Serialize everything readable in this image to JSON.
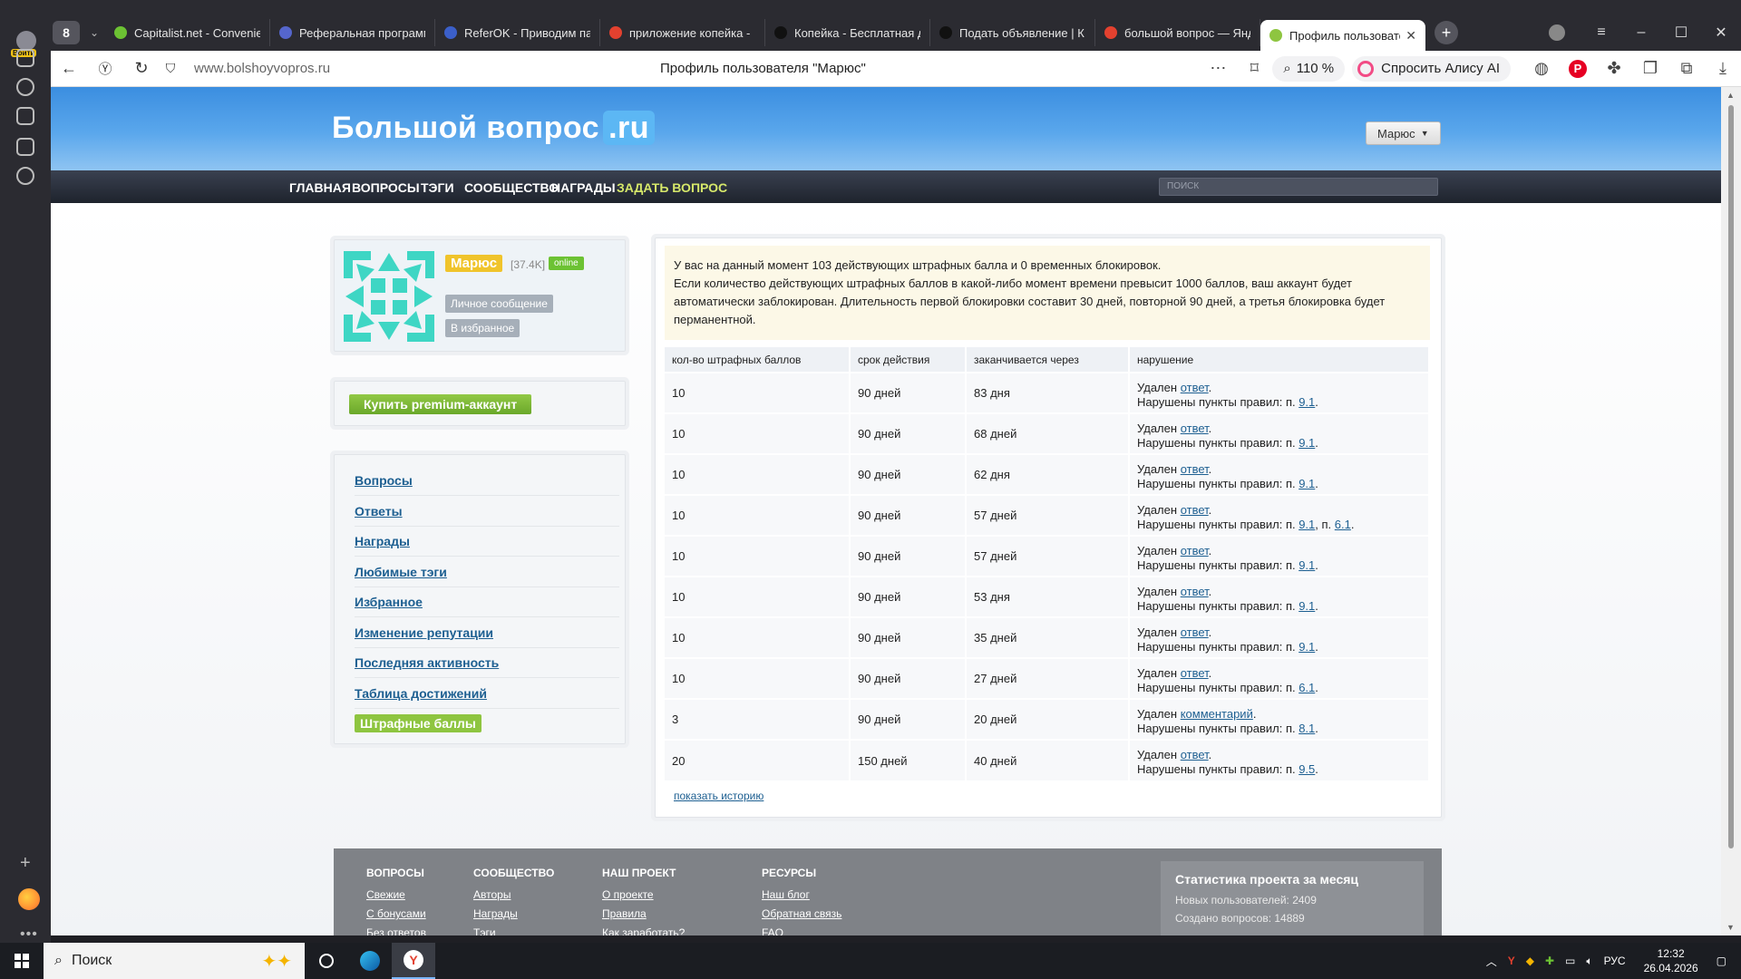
{
  "browser": {
    "tab_count": "8",
    "tabs": [
      {
        "label": "Capitalist.net - Convenie",
        "color": "#6cc233"
      },
      {
        "label": "Реферальная программа",
        "color": "#5566cc"
      },
      {
        "label": "ReferOK - Приводим пар",
        "color": "#3b5fc9"
      },
      {
        "label": "приложение копейка -",
        "color": "#e3412f"
      },
      {
        "label": "Копейка - Бесплатная д",
        "color": "#111111"
      },
      {
        "label": "Подать объявление | К",
        "color": "#111111"
      },
      {
        "label": "большой вопрос — Янд",
        "color": "#e3412f"
      },
      {
        "label": "Профиль пользовате",
        "color": "#8ec540"
      }
    ],
    "login_badge": "Войти",
    "url": "www.bolshoyvopros.ru",
    "page_title": "Профиль пользователя \"Марюс\"",
    "zoom": "110 %",
    "alice_label": "Спросить Алису AI"
  },
  "site": {
    "logo_main": "Большой вопрос",
    "logo_ru": ".ru",
    "user_menu": "Марюс",
    "nav": [
      {
        "label": "ГЛАВНАЯ",
        "ask": false
      },
      {
        "label": "ВОПРОСЫ",
        "ask": false
      },
      {
        "label": "ТЭГИ",
        "ask": false
      },
      {
        "label": "СООБЩЕСТВО",
        "ask": false
      },
      {
        "label": "НАГРАДЫ",
        "ask": false
      },
      {
        "label": "ЗАДАТЬ ВОПРОС",
        "ask": true
      }
    ],
    "search_placeholder": "ПОИСК"
  },
  "profile": {
    "username": "Марюс",
    "reputation": "[37.4K]",
    "online": "online",
    "private_message": "Личное сообщение",
    "add_favorite": "В избранное",
    "premium": "Купить premium-аккаунт"
  },
  "menu": [
    {
      "label": "Вопросы",
      "current": false
    },
    {
      "label": "Ответы",
      "current": false
    },
    {
      "label": "Награды",
      "current": false
    },
    {
      "label": "Любимые тэги",
      "current": false
    },
    {
      "label": "Избранное",
      "current": false
    },
    {
      "label": "Изменение репутации",
      "current": false
    },
    {
      "label": "Последняя активность",
      "current": false
    },
    {
      "label": "Таблица достижений",
      "current": false
    },
    {
      "label": "Штрафные баллы",
      "current": true
    }
  ],
  "notice": {
    "line1": "У вас на данный момент 103 действующих штрафных балла и 0 временных блокировок.",
    "line2": "Если количество действующих штрафных баллов в какой-либо момент времени превысит 1000 баллов, ваш аккаунт будет автоматически заблокирован. Длительность первой блокировки составит 30 дней, повторной 90 дней, а третья блокировка будет перманентной."
  },
  "table": {
    "headers": [
      "кол-во штрафных баллов",
      "срок действия",
      "заканчивается через",
      "нарушение"
    ],
    "removed_prefix": "Удален",
    "rules_prefix": "Нарушены пункты правил:",
    "rows": [
      {
        "points": "10",
        "duration": "90 дней",
        "ends": "83 дня",
        "object": "ответ",
        "rules": [
          "9.1"
        ]
      },
      {
        "points": "10",
        "duration": "90 дней",
        "ends": "68 дней",
        "object": "ответ",
        "rules": [
          "9.1"
        ]
      },
      {
        "points": "10",
        "duration": "90 дней",
        "ends": "62 дня",
        "object": "ответ",
        "rules": [
          "9.1"
        ]
      },
      {
        "points": "10",
        "duration": "90 дней",
        "ends": "57 дней",
        "object": "ответ",
        "rules": [
          "9.1",
          "6.1"
        ]
      },
      {
        "points": "10",
        "duration": "90 дней",
        "ends": "57 дней",
        "object": "ответ",
        "rules": [
          "9.1"
        ]
      },
      {
        "points": "10",
        "duration": "90 дней",
        "ends": "53 дня",
        "object": "ответ",
        "rules": [
          "9.1"
        ]
      },
      {
        "points": "10",
        "duration": "90 дней",
        "ends": "35 дней",
        "object": "ответ",
        "rules": [
          "9.1"
        ]
      },
      {
        "points": "10",
        "duration": "90 дней",
        "ends": "27 дней",
        "object": "ответ",
        "rules": [
          "6.1"
        ]
      },
      {
        "points": "3",
        "duration": "90 дней",
        "ends": "20 дней",
        "object": "комментарий",
        "rules": [
          "8.1"
        ]
      },
      {
        "points": "20",
        "duration": "150 дней",
        "ends": "40 дней",
        "object": "ответ",
        "rules": [
          "9.5"
        ]
      }
    ],
    "history_link": "показать историю"
  },
  "footer": {
    "columns": [
      {
        "title": "ВОПРОСЫ",
        "links": [
          "Свежие",
          "С бонусами",
          "Без ответов"
        ]
      },
      {
        "title": "СООБЩЕСТВО",
        "links": [
          "Авторы",
          "Награды",
          "Тэги"
        ]
      },
      {
        "title": "НАШ ПРОЕКТ",
        "links": [
          "О проекте",
          "Правила",
          "Как заработать?"
        ]
      },
      {
        "title": "РЕСУРСЫ",
        "links": [
          "Наш блог",
          "Обратная связь",
          "FAQ"
        ]
      }
    ],
    "stats_title": "Статистика проекта за месяц",
    "stats": [
      "Новых пользователей: 2409",
      "Создано вопросов: 14889"
    ]
  },
  "taskbar": {
    "search": "Поиск",
    "lang": "РУС",
    "time": "12:32",
    "date": "26.04.2026"
  }
}
